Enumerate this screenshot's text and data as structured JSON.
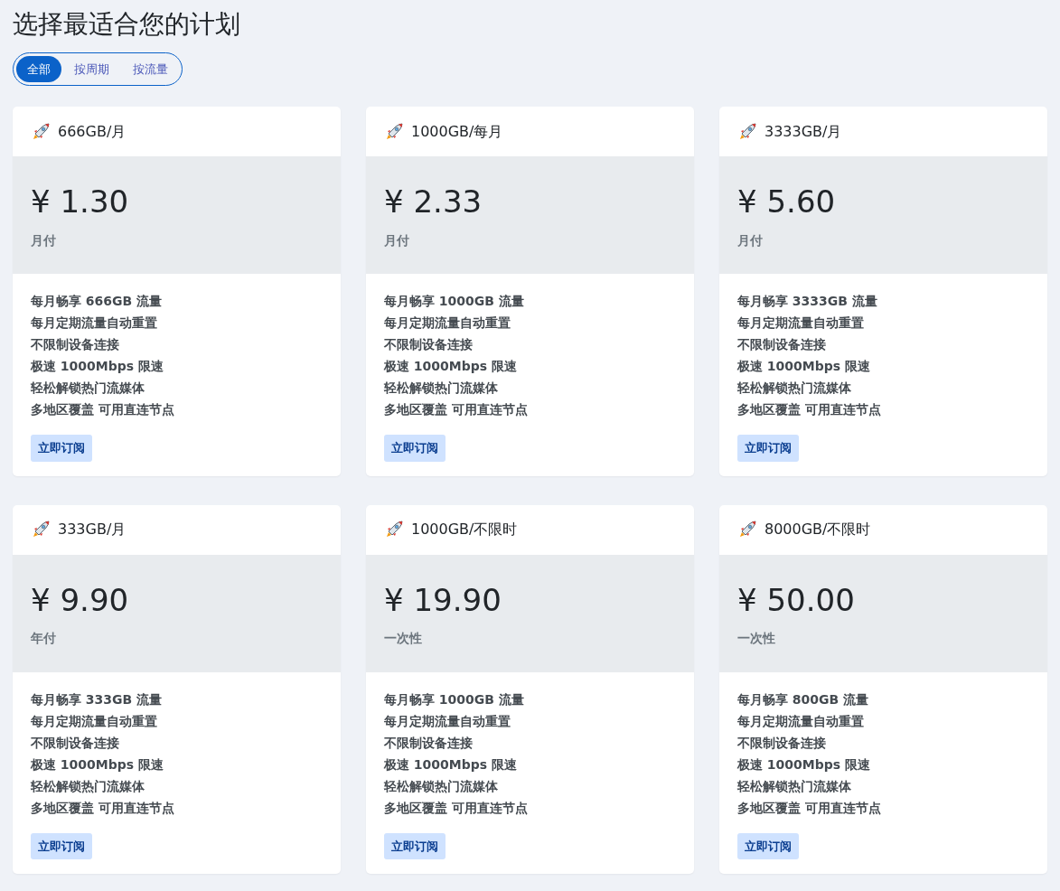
{
  "title": "选择最适合您的计划",
  "filters": [
    {
      "label": "全部",
      "selected": true
    },
    {
      "label": "按周期",
      "selected": false
    },
    {
      "label": "按流量",
      "selected": false
    }
  ],
  "plans": [
    {
      "name": "666GB/月",
      "price": "¥ 1.30",
      "period": "月付",
      "features": [
        "每月畅享 666GB 流量",
        "每月定期流量自动重置",
        "不限制设备连接",
        "极速 1000Mbps 限速",
        "轻松解锁热门流媒体",
        "多地区覆盖 可用直连节点"
      ],
      "button": "立即订阅"
    },
    {
      "name": "1000GB/每月",
      "price": "¥ 2.33",
      "period": "月付",
      "features": [
        "每月畅享 1000GB 流量",
        "每月定期流量自动重置",
        "不限制设备连接",
        "极速 1000Mbps 限速",
        "轻松解锁热门流媒体",
        "多地区覆盖 可用直连节点"
      ],
      "button": "立即订阅"
    },
    {
      "name": "3333GB/月",
      "price": "¥ 5.60",
      "period": "月付",
      "features": [
        "每月畅享 3333GB 流量",
        "每月定期流量自动重置",
        "不限制设备连接",
        "极速 1000Mbps 限速",
        "轻松解锁热门流媒体",
        "多地区覆盖 可用直连节点"
      ],
      "button": "立即订阅"
    },
    {
      "name": "333GB/月",
      "price": "¥ 9.90",
      "period": "年付",
      "features": [
        "每月畅享 333GB 流量",
        "每月定期流量自动重置",
        "不限制设备连接",
        "极速 1000Mbps 限速",
        "轻松解锁热门流媒体",
        "多地区覆盖 可用直连节点"
      ],
      "button": "立即订阅"
    },
    {
      "name": "1000GB/不限时",
      "price": "¥ 19.90",
      "period": "一次性",
      "features": [
        "每月畅享 1000GB 流量",
        "每月定期流量自动重置",
        "不限制设备连接",
        "极速 1000Mbps 限速",
        "轻松解锁热门流媒体",
        "多地区覆盖 可用直连节点"
      ],
      "button": "立即订阅"
    },
    {
      "name": "8000GB/不限时",
      "price": "¥ 50.00",
      "period": "一次性",
      "features": [
        "每月畅享 800GB 流量",
        "每月定期流量自动重置",
        "不限制设备连接",
        "极速 1000Mbps 限速",
        "轻松解锁热门流媒体",
        "多地区覆盖 可用直连节点"
      ],
      "button": "立即订阅"
    }
  ]
}
